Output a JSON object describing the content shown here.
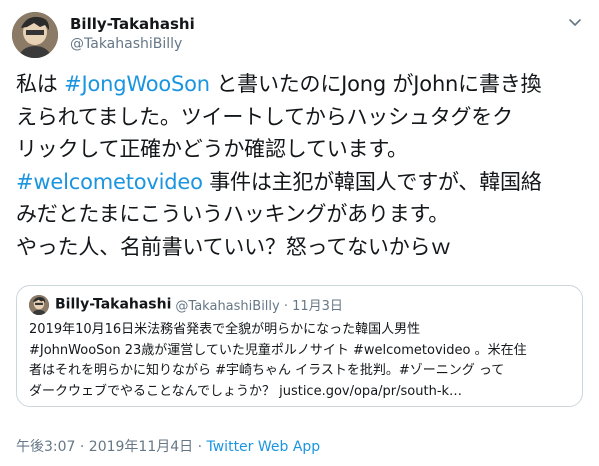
{
  "author": {
    "display_name": "Billy-Takahashi",
    "handle": "@TakahashiBilly"
  },
  "tweet": {
    "lines": [
      [
        {
          "t": "私は ",
          "h": false
        },
        {
          "t": "#JongWooSon",
          "h": true
        },
        {
          "t": " と書いたのにJong がJohnに書き換",
          "h": false
        }
      ],
      [
        {
          "t": "えられてました。ツイートしてからハッシュタグをク",
          "h": false
        }
      ],
      [
        {
          "t": "リックして正確かどうか確認しています。",
          "h": false
        }
      ],
      [
        {
          "t": "#welcometovideo",
          "h": true
        },
        {
          "t": " 事件は主犯が韓国人ですが、韓国絡",
          "h": false
        }
      ],
      [
        {
          "t": "みだとたまにこういうハッキングがあります。",
          "h": false
        }
      ],
      [
        {
          "t": "やった人、名前書いていい？怒ってないからｗ",
          "h": false
        }
      ]
    ]
  },
  "quoted_tweet": {
    "display_name": "Billy-Takahashi",
    "handle_and_date": "@TakahashiBilly · 11月3日",
    "lines": [
      "2019年10月16日米法務省発表で全貌が明らかになった韓国人男性",
      "#JohnWooSon 23歳が運営していた児童ポルノサイト #welcometovideo 。米在住",
      "者はそれを明らかに知りながら #宇崎ちゃん イラストを批判。#ゾーニング って",
      "ダークウェブでやることなんでしょうか？ justice.gov/opa/pr/south-k…"
    ]
  },
  "meta": {
    "timestamp": "午後3:07 · 2019年11月4日 · ",
    "source": "Twitter Web App"
  },
  "colors": {
    "hashtag": "#1b95e0",
    "secondary_text": "#657786",
    "border": "#ccd6dd"
  }
}
